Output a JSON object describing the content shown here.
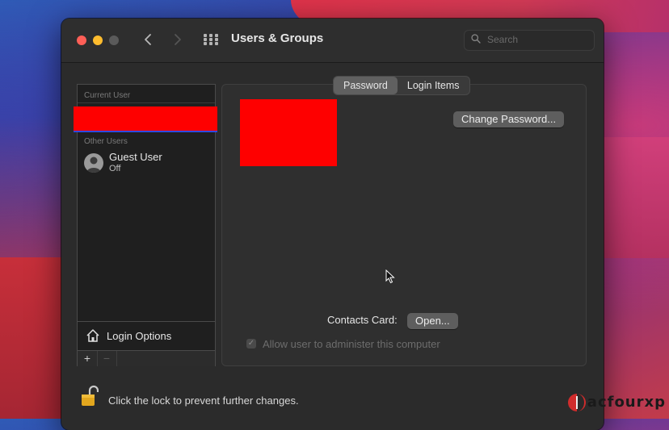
{
  "window": {
    "title": "Users & Groups",
    "search_placeholder": "Search"
  },
  "sidebar": {
    "current_user_label": "Current User",
    "other_users_label": "Other Users",
    "guest": {
      "name": "Guest User",
      "status": "Off"
    },
    "login_options_label": "Login Options",
    "add_label": "+",
    "remove_label": "−"
  },
  "tabs": [
    {
      "label": "Password",
      "active": true
    },
    {
      "label": "Login Items",
      "active": false
    }
  ],
  "panel": {
    "change_password_label": "Change Password...",
    "contacts_card_label": "Contacts Card:",
    "open_label": "Open...",
    "admin_checkbox_label": "Allow user to administer this computer",
    "admin_checked": true
  },
  "footer": {
    "lock_text": "Click the lock to prevent further changes."
  },
  "watermark": {
    "text": "acfourxp"
  },
  "colors": {
    "redaction": "#fe0000",
    "close": "#fe5f57",
    "minimize": "#febc2e"
  },
  "icons": [
    "back-icon",
    "forward-icon",
    "grid-icon",
    "search-icon",
    "person-icon",
    "house-icon",
    "lock-icon",
    "cursor-icon"
  ]
}
